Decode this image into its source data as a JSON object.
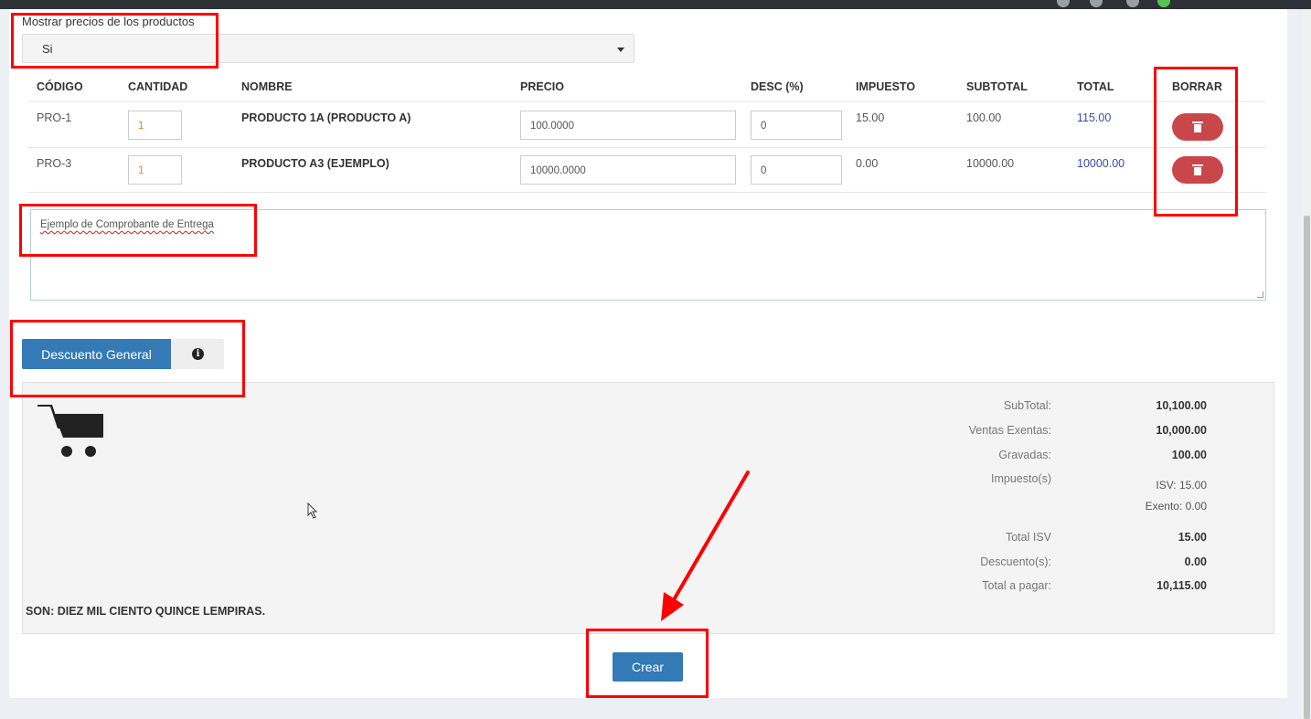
{
  "price_display": {
    "label": "Mostrar precios de los productos",
    "selected": "Si"
  },
  "table": {
    "headers": [
      "CÓDIGO",
      "CANTIDAD",
      "NOMBRE",
      "PRECIO",
      "DESC (%)",
      "IMPUESTO",
      "SUBTOTAL",
      "TOTAL",
      "BORRAR"
    ],
    "rows": [
      {
        "code": "PRO-1",
        "qty": "1",
        "name": "PRODUCTO 1A (PRODUCTO A)",
        "price": "100.0000",
        "discount": "0",
        "tax": "15.00",
        "subtotal": "100.00",
        "total": "115.00"
      },
      {
        "code": "PRO-3",
        "qty": "1",
        "name": "PRODUCTO A3 (EJEMPLO)",
        "price": "10000.0000",
        "discount": "0",
        "tax": "0.00",
        "subtotal": "10000.00",
        "total": "10000.00"
      }
    ]
  },
  "notes": {
    "value": "Ejemplo de Comprobante de Entrega"
  },
  "discount": {
    "button_label": "Descuento General",
    "info_icon": "info-circle-icon"
  },
  "summary": {
    "subtotal_label": "SubTotal:",
    "subtotal_value": "10,100.00",
    "exempt_label": "Ventas Exentas:",
    "exempt_value": "10,000.00",
    "taxed_label": "Gravadas:",
    "taxed_value": "100.00",
    "taxes_label": "Impuesto(s)",
    "isv_value": "ISV: 15.00",
    "exento_value": "Exento: 0.00",
    "total_isv_label": "Total ISV",
    "total_isv_value": "15.00",
    "discounts_label": "Descuento(s):",
    "discounts_value": "0.00",
    "total_label": "Total a pagar:",
    "total_value": "10,115.00",
    "amount_words": "SON: DIEZ MIL CIENTO QUINCE LEMPIRAS.",
    "cart_icon": "shopping-cart-icon"
  },
  "actions": {
    "create_label": "Crear"
  },
  "colors": {
    "primary": "#337ab7",
    "danger": "#c9474a",
    "highlight": "#ff0000"
  }
}
